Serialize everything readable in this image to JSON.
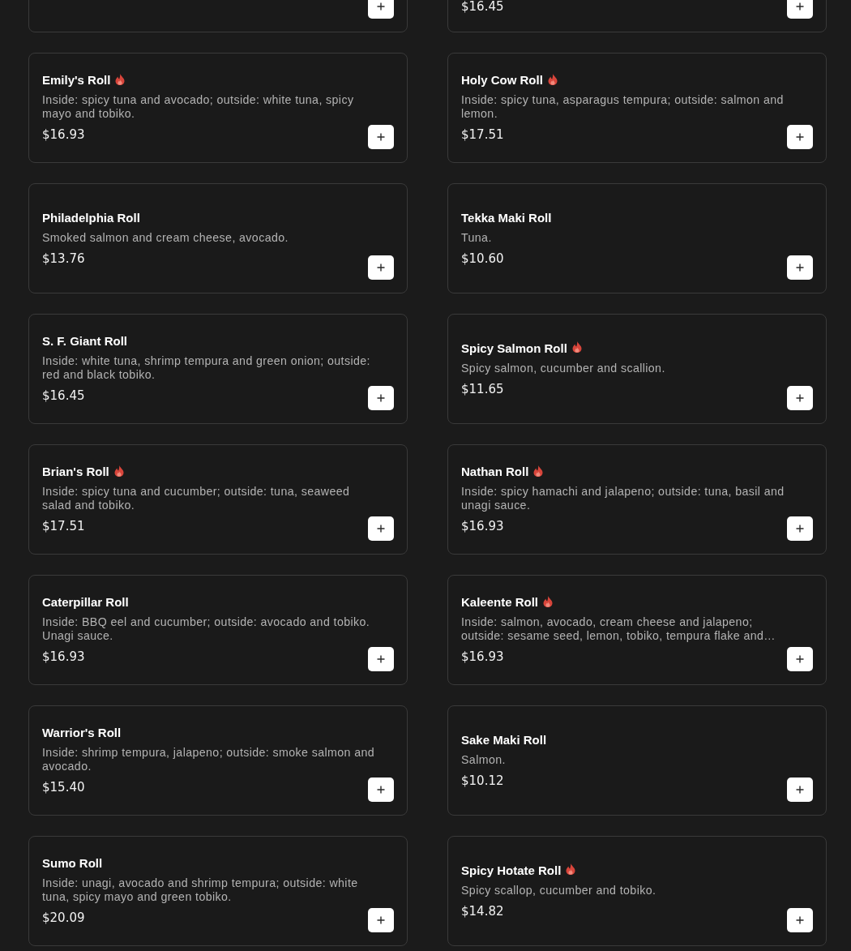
{
  "items": [
    {
      "kind": "cut"
    },
    {
      "kind": "cut",
      "price": "$16.45"
    },
    {
      "kind": "full",
      "name": "Emily's Roll",
      "spicy": true,
      "description": "Inside: spicy tuna and avocado; outside: white tuna, spicy mayo and tobiko.",
      "price": "$16.93"
    },
    {
      "kind": "full",
      "name": "Holy Cow Roll",
      "spicy": true,
      "description": "Inside: spicy tuna, asparagus tempura; outside: salmon and lemon.",
      "price": "$17.51"
    },
    {
      "kind": "full",
      "name": "Philadelphia Roll",
      "spicy": false,
      "description": "Smoked salmon and cream cheese, avocado.",
      "price": "$13.76"
    },
    {
      "kind": "full",
      "name": "Tekka Maki Roll",
      "spicy": false,
      "description": "Tuna.",
      "price": "$10.60"
    },
    {
      "kind": "full",
      "name": "S. F. Giant Roll",
      "spicy": false,
      "description": "Inside: white tuna, shrimp tempura and green onion; outside: red and black tobiko.",
      "price": "$16.45"
    },
    {
      "kind": "full",
      "name": "Spicy Salmon Roll",
      "spicy": true,
      "description": "Spicy salmon, cucumber and scallion.",
      "price": "$11.65"
    },
    {
      "kind": "full",
      "name": "Brian's Roll",
      "spicy": true,
      "description": "Inside: spicy tuna and cucumber; outside: tuna, seaweed salad and tobiko.",
      "price": "$17.51"
    },
    {
      "kind": "full",
      "name": "Nathan Roll",
      "spicy": true,
      "description": "Inside: spicy hamachi and jalapeno; outside: tuna, basil and unagi sauce.",
      "price": "$16.93"
    },
    {
      "kind": "full",
      "name": "Caterpillar Roll",
      "spicy": false,
      "description": "Inside: BBQ eel and cucumber; outside: avocado and tobiko. Unagi sauce.",
      "price": "$16.93"
    },
    {
      "kind": "full",
      "name": "Kaleente Roll",
      "spicy": true,
      "description": "Inside: salmon, avocado, cream cheese and jalapeno; outside: sesame seed, lemon, tobiko, tempura flake and…",
      "price": "$16.93"
    },
    {
      "kind": "full",
      "name": "Warrior's Roll",
      "spicy": false,
      "description": "Inside: shrimp tempura, jalapeno; outside: smoke salmon and avocado.",
      "price": "$15.40"
    },
    {
      "kind": "full",
      "name": "Sake Maki Roll",
      "spicy": false,
      "description": "Salmon.",
      "price": "$10.12"
    },
    {
      "kind": "full",
      "name": "Sumo Roll",
      "spicy": false,
      "description": "Inside: unagi, avocado and shrimp tempura; outside: white tuna, spicy mayo and green tobiko.",
      "price": "$20.09"
    },
    {
      "kind": "full",
      "name": "Spicy Hotate Roll",
      "spicy": true,
      "description": "Spicy scallop, cucumber and tobiko.",
      "price": "$14.82"
    }
  ]
}
